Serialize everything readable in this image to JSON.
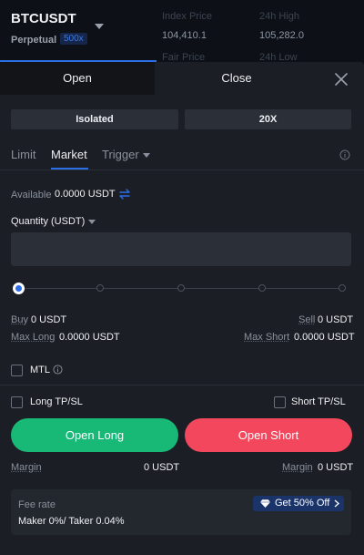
{
  "header": {
    "symbol": "BTCUSDT",
    "contract_type": "Perpetual",
    "leverage_badge": "500x",
    "index_price_label": "Index Price",
    "index_price_value": "104,410.1",
    "high_label": "24h High",
    "high_value": "105,282.0",
    "fair_price_label": "Fair Price",
    "low_label": "24h Low"
  },
  "tabs": {
    "open": "Open",
    "close": "Close"
  },
  "margin_mode": {
    "mode": "Isolated",
    "leverage": "20X"
  },
  "order_types": {
    "limit": "Limit",
    "market": "Market",
    "trigger": "Trigger",
    "selected": "Market"
  },
  "available": {
    "label": "Available",
    "value": "0.0000 USDT"
  },
  "quantity": {
    "label": "Quantity (USDT)",
    "value": "",
    "placeholder": ""
  },
  "slider": {
    "percent": 0,
    "ticks": [
      0,
      25,
      50,
      75,
      100
    ]
  },
  "order_info": {
    "buy_label": "Buy",
    "buy_value": "0 USDT",
    "sell_label": "Sell",
    "sell_value": "0 USDT",
    "max_long_label": "Max Long",
    "max_long_value": "0.0000 USDT",
    "max_short_label": "Max Short",
    "max_short_value": "0.0000 USDT"
  },
  "options": {
    "mtl": "MTL",
    "long_tpsl": "Long TP/SL",
    "short_tpsl": "Short TP/SL"
  },
  "actions": {
    "open_long": "Open Long",
    "open_short": "Open Short"
  },
  "margin": {
    "long_label": "Margin",
    "long_value": "0 USDT",
    "short_label": "Margin",
    "short_value": "0 USDT"
  },
  "fees": {
    "label": "Fee rate",
    "value": "Maker 0%/ Taker 0.04%",
    "promo": "Get 50% Off"
  },
  "colors": {
    "accent": "#2b6ee6",
    "long": "#18b877",
    "short": "#f2475c",
    "panel_bg": "#1b1e24"
  },
  "icons": [
    "caret-down-icon",
    "close-icon",
    "info-icon",
    "swap-icon",
    "diamond-icon",
    "chevron-right-icon"
  ]
}
